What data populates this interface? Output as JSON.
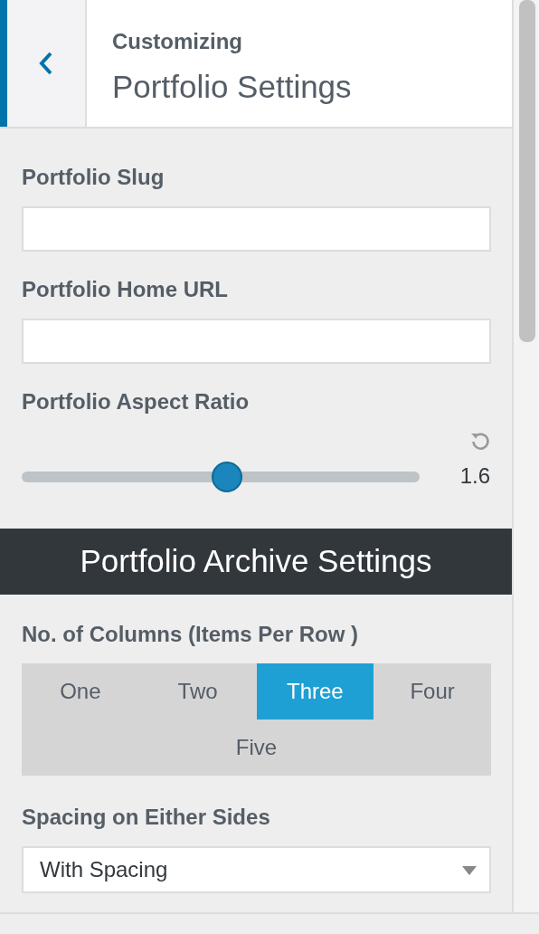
{
  "header": {
    "subtitle": "Customizing",
    "title": "Portfolio Settings"
  },
  "controls": [
    {
      "kind": "text",
      "label": "Portfolio Slug"
    },
    {
      "kind": "text",
      "label": "Portfolio Home URL"
    },
    {
      "kind": "slider",
      "label": "Portfolio Aspect Ratio",
      "level": 0.515,
      "reading": "1.6"
    },
    {
      "kind": "heading",
      "label": "Portfolio Archive Settings"
    },
    {
      "kind": "choice",
      "label": "No. of Columns (Items Per Row )",
      "options": [
        {
          "label": "One",
          "selected": false
        },
        {
          "label": "Two",
          "selected": false
        },
        {
          "label": "Three",
          "selected": true
        },
        {
          "label": "Four",
          "selected": false
        },
        {
          "label": "Five",
          "selected": false
        }
      ]
    },
    {
      "kind": "select",
      "label": "Spacing on Either Sides",
      "value": "With Spacing"
    }
  ]
}
